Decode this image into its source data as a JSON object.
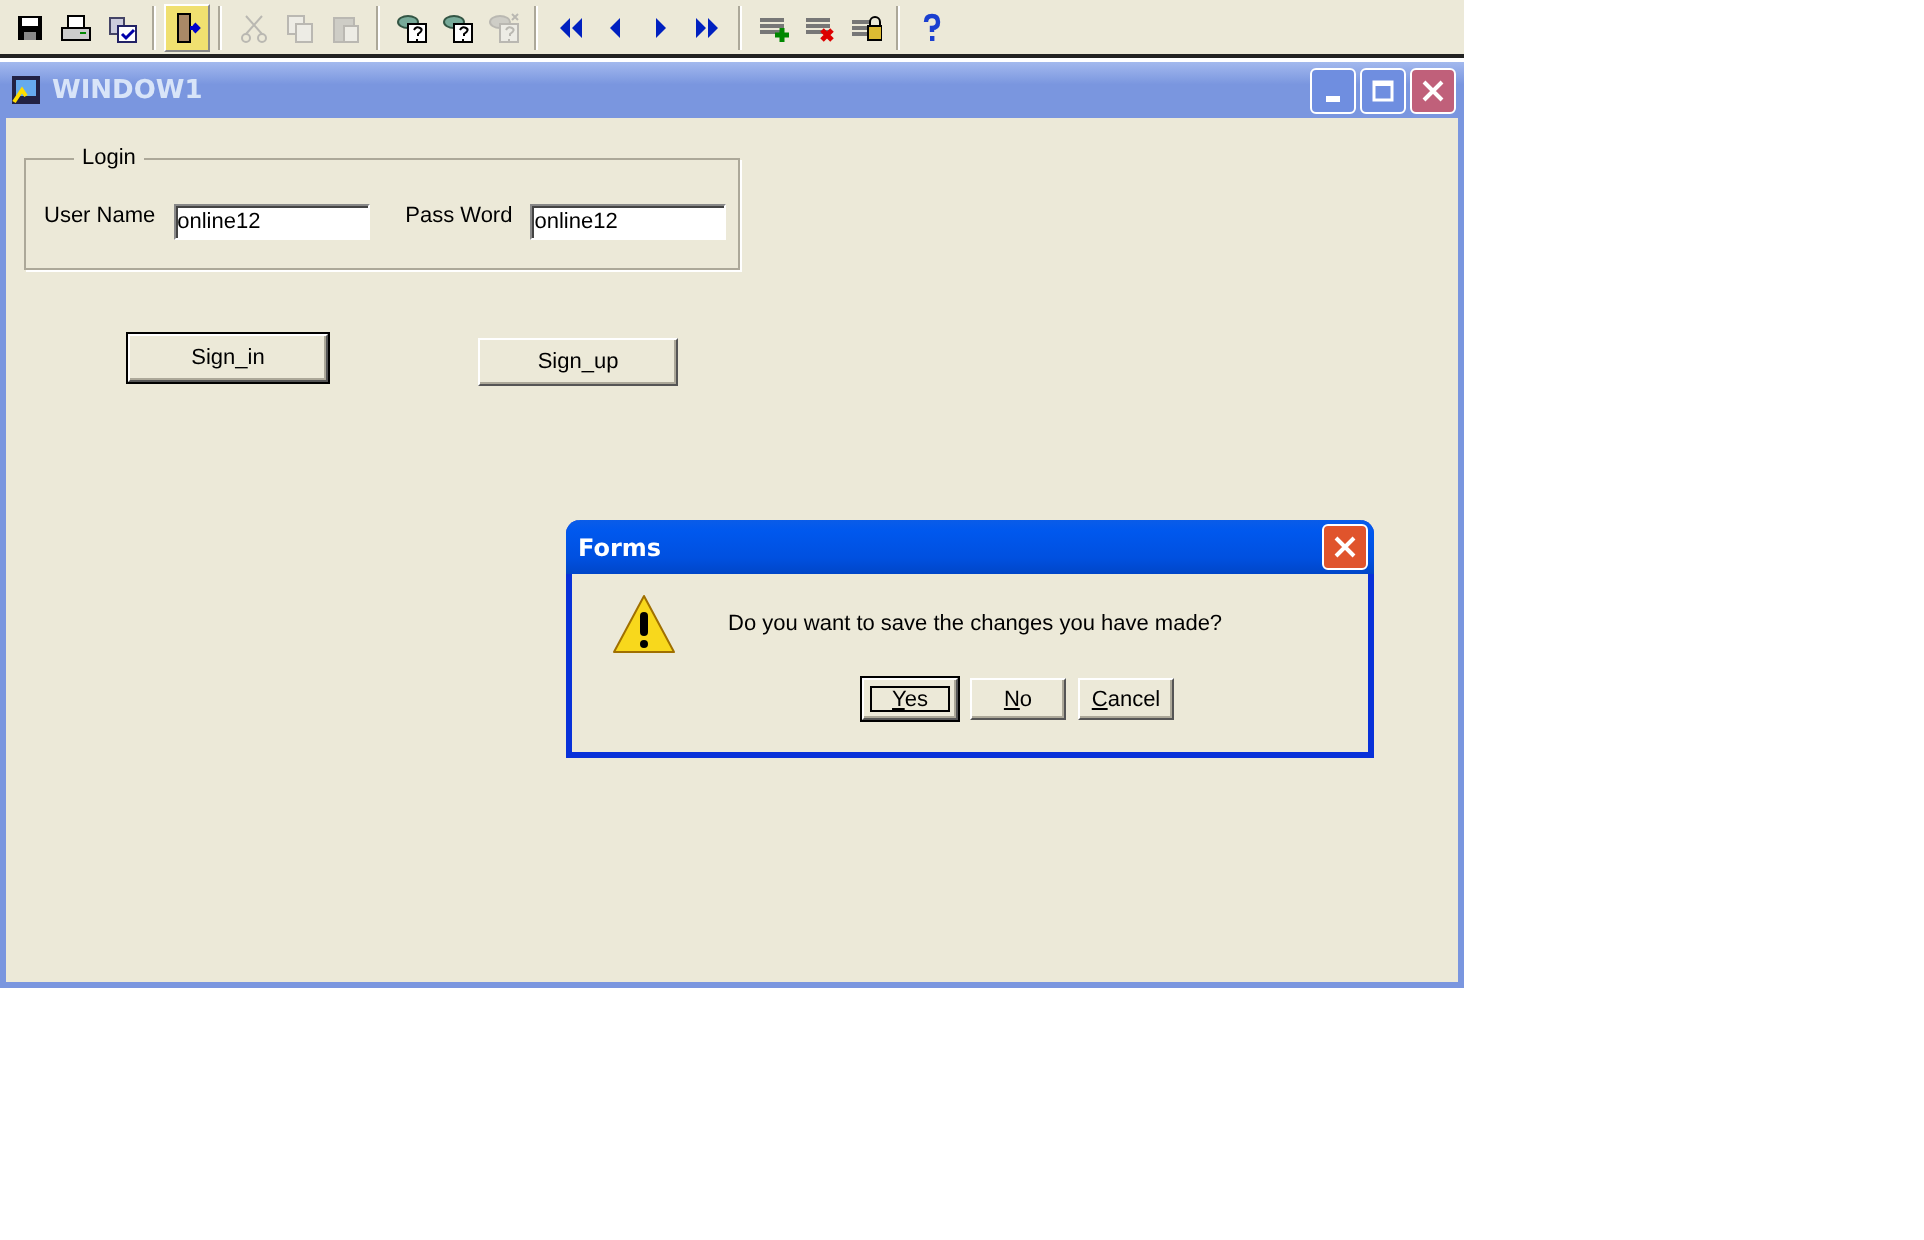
{
  "toolbar": [
    {
      "kind": "save",
      "disabled": false,
      "highlighted": false
    },
    {
      "kind": "print",
      "disabled": false,
      "highlighted": false
    },
    {
      "kind": "commit",
      "disabled": false,
      "highlighted": false,
      "separator_after": true
    },
    {
      "kind": "exit",
      "disabled": false,
      "highlighted": true,
      "separator_after": true
    },
    {
      "kind": "cut",
      "disabled": true,
      "highlighted": false
    },
    {
      "kind": "copy",
      "disabled": true,
      "highlighted": false
    },
    {
      "kind": "paste",
      "disabled": true,
      "highlighted": false,
      "separator_after": true
    },
    {
      "kind": "query",
      "disabled": false,
      "highlighted": false
    },
    {
      "kind": "query",
      "disabled": false,
      "highlighted": false
    },
    {
      "kind": "query-cancel",
      "disabled": true,
      "highlighted": false,
      "separator_after": true
    },
    {
      "kind": "first",
      "disabled": false,
      "highlighted": false
    },
    {
      "kind": "prev",
      "disabled": false,
      "highlighted": false
    },
    {
      "kind": "next",
      "disabled": false,
      "highlighted": false
    },
    {
      "kind": "last",
      "disabled": false,
      "highlighted": false,
      "separator_after": true
    },
    {
      "kind": "insert",
      "disabled": false,
      "highlighted": false
    },
    {
      "kind": "delete",
      "disabled": false,
      "highlighted": false
    },
    {
      "kind": "lock",
      "disabled": false,
      "highlighted": false,
      "separator_after": true
    },
    {
      "kind": "help",
      "disabled": false,
      "highlighted": false
    }
  ],
  "window": {
    "title": "WINDOW1",
    "active": false,
    "login_group": {
      "title": "Login",
      "fields": [
        {
          "label": "User Name",
          "value": "online12"
        },
        {
          "label": "Pass Word",
          "value": "online12"
        }
      ]
    },
    "buttons": [
      {
        "label": "Sign_in",
        "default": true
      },
      {
        "label": "Sign_up",
        "default": false
      }
    ]
  },
  "dialog": {
    "title": "Forms",
    "message": "Do you want to save the changes you have made?",
    "buttons": [
      {
        "label": "Yes",
        "default": true,
        "underline_first": true
      },
      {
        "label": "No",
        "default": false,
        "underline_first": true
      },
      {
        "label": "Cancel",
        "default": false,
        "underline_first": true
      }
    ]
  }
}
